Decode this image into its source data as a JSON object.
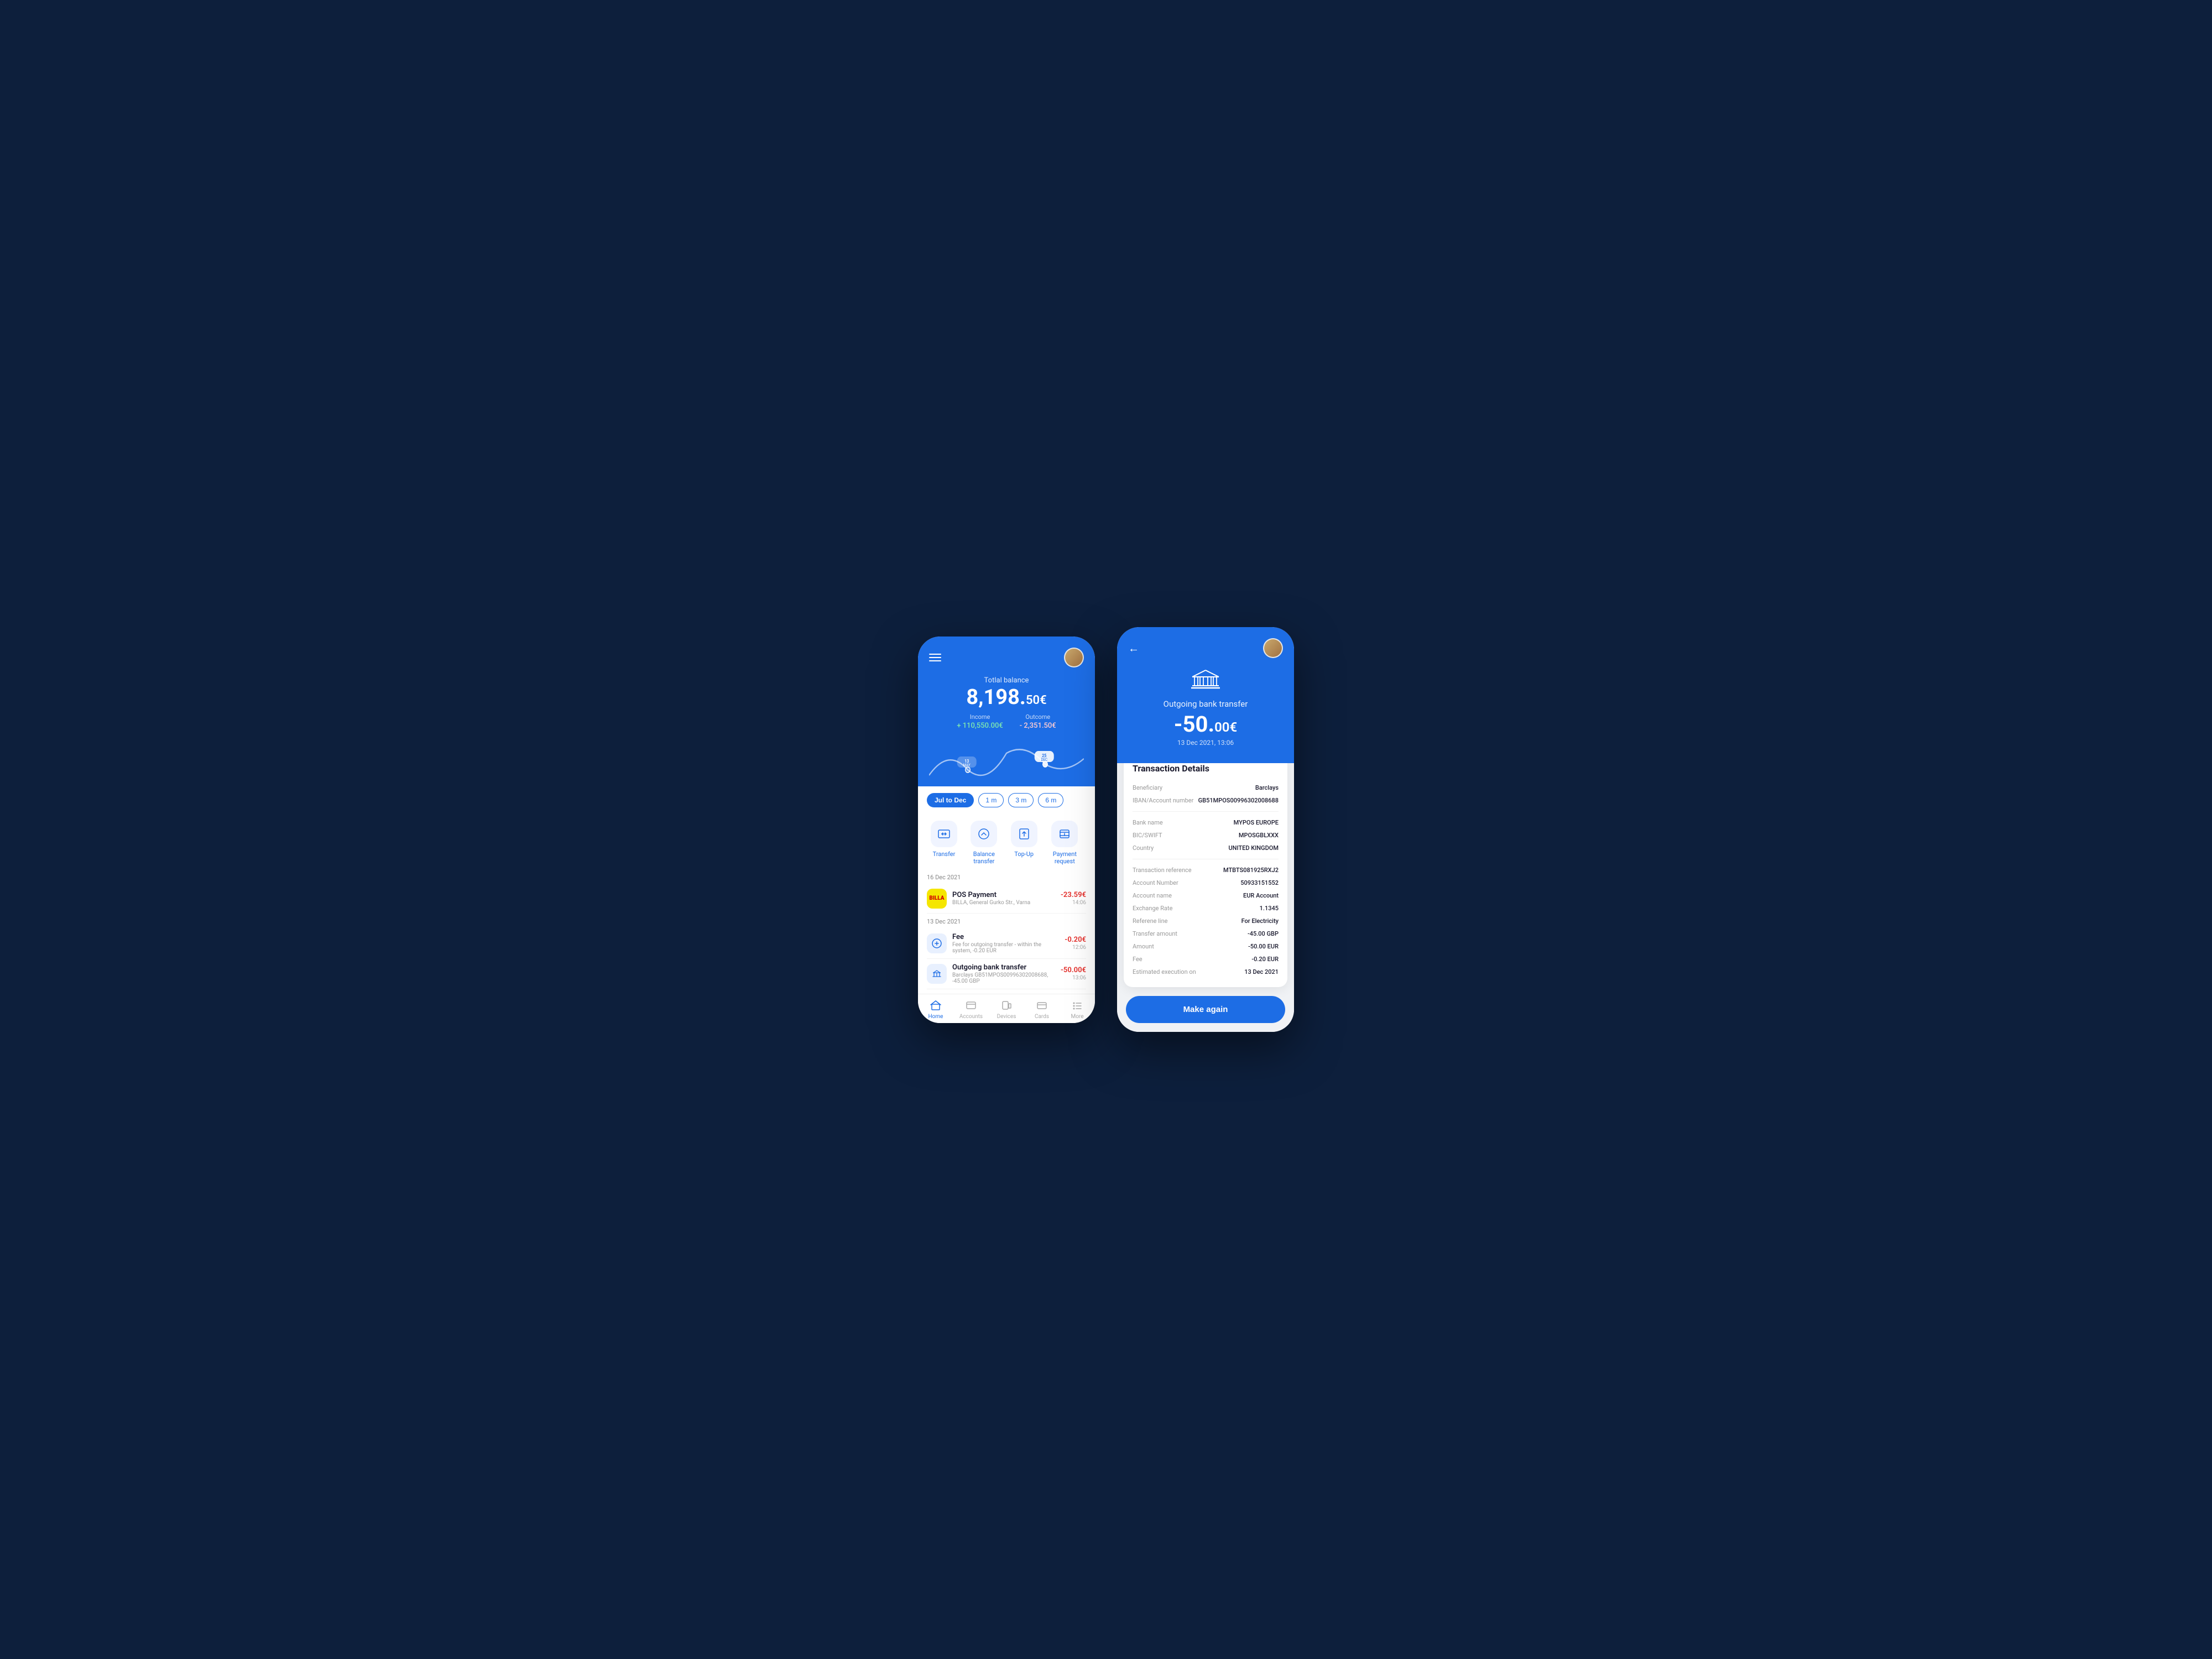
{
  "leftPhone": {
    "header": {
      "balanceLabel": "Totlal balance",
      "balanceMain": "8,198.",
      "balanceCents": "50€",
      "incomeLabel": "Income",
      "incomeValue": "+ 110,550.00€",
      "outcomeLabel": "Outcome",
      "outcomeValue": "- 2,351.50€",
      "dateBubble1": "13\nMAY",
      "dateBubble2": "25\nDEC"
    },
    "dateRange": {
      "activeBtn": "Jul to Dec",
      "options": [
        "1 m",
        "3 m",
        "6 m"
      ]
    },
    "quickActions": [
      {
        "id": "transfer",
        "label": "Transfer"
      },
      {
        "id": "balance-transfer",
        "label": "Balance transfer"
      },
      {
        "id": "topup",
        "label": "Top-Up"
      },
      {
        "id": "payment-request",
        "label": "Payment request"
      }
    ],
    "transactions": [
      {
        "dateHeader": "16 Dec 2021",
        "items": [
          {
            "icon": "billa",
            "name": "POS Payment",
            "desc": "BILLA, General Gurko Str., Varna",
            "amount": "-23.59€",
            "time": "14:06"
          }
        ]
      },
      {
        "dateHeader": "13 Dec 2021",
        "items": [
          {
            "icon": "fee",
            "name": "Fee",
            "desc": "Fee for outgoing transfer - within the system, -0.20 EUR",
            "amount": "-0.20€",
            "time": "12:06"
          },
          {
            "icon": "bank",
            "name": "Outgoing bank transfer",
            "desc": "Barclays GB51MPOS00996302008688, -45.00 GBP",
            "amount": "-50.00€",
            "time": "13:06"
          }
        ]
      }
    ],
    "bottomNav": [
      {
        "id": "home",
        "label": "Home",
        "active": true
      },
      {
        "id": "accounts",
        "label": "Accounts",
        "active": false
      },
      {
        "id": "devices",
        "label": "Devices",
        "active": false
      },
      {
        "id": "cards",
        "label": "Cards",
        "active": false
      },
      {
        "id": "more",
        "label": "More",
        "active": false
      }
    ]
  },
  "rightPhone": {
    "header": {
      "title": "Outgoing bank transfer",
      "amountMain": "-50.",
      "amountCents": "00€",
      "date": "13 Dec 2021, 13:06"
    },
    "detailCard": {
      "title": "Transaction Details",
      "groups": [
        {
          "rows": [
            {
              "label": "Beneficiary",
              "value": "Barclays"
            },
            {
              "label": "IBAN/Account number",
              "value": "GB51MPOS00996302008688"
            }
          ]
        },
        {
          "rows": [
            {
              "label": "Bank name",
              "value": "MYPOS EUROPE"
            },
            {
              "label": "BIC/SWIFT",
              "value": "MPOSGBLXXX"
            },
            {
              "label": "Country",
              "value": "UNITED KINGDOM"
            }
          ]
        },
        {
          "rows": [
            {
              "label": "Transaction reference",
              "value": "MTBTS081925RXJ2"
            },
            {
              "label": "Account Number",
              "value": "50933151552"
            },
            {
              "label": "Account name",
              "value": "EUR Account"
            },
            {
              "label": "Exchange Rate",
              "value": "1.1345"
            },
            {
              "label": "Referene line",
              "value": "For Electricity"
            },
            {
              "label": "Transfer amount",
              "value": "-45.00 GBP"
            },
            {
              "label": "Amount",
              "value": "-50.00 EUR"
            },
            {
              "label": "Fee",
              "value": "-0.20 EUR"
            },
            {
              "label": "Estimated execution on",
              "value": "13 Dec 2021"
            }
          ]
        }
      ]
    },
    "makeAgainBtn": "Make again"
  }
}
